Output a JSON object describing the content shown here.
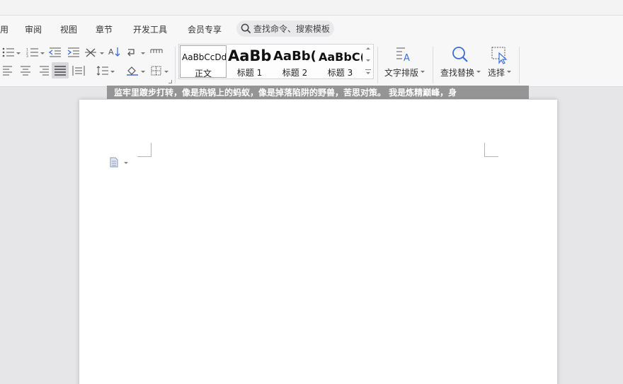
{
  "menu": {
    "items": [
      "用",
      "审阅",
      "视图",
      "章节",
      "开发工具",
      "会员专享"
    ],
    "search_label": "查找命令、搜索模板"
  },
  "icons": {
    "search": "search-icon",
    "bullet_list": "bullet-list-icon",
    "numbered_list": "numbered-list-icon",
    "decrease_indent": "decrease-indent-icon",
    "increase_indent": "increase-indent-icon",
    "chinese_layout": "chinese-layout-icon",
    "sort": "sort-icon",
    "paragraph_mark": "paragraph-mark-icon",
    "tab_ruler": "tab-ruler-icon",
    "align_left": "align-left-icon",
    "align_center": "align-center-icon",
    "align_right": "align-right-icon",
    "justify": "justify-icon",
    "distributed": "distributed-align-icon",
    "line_spacing": "line-spacing-icon",
    "shading": "shading-icon",
    "borders": "borders-icon",
    "text_layout": "text-layout-icon",
    "find_replace": "find-replace-icon",
    "select": "select-cursor-icon",
    "doc": "document-icon"
  },
  "styles": [
    {
      "sample": "AaBbCcDd",
      "name": "正文"
    },
    {
      "sample": "AaBb",
      "name": "标题 1"
    },
    {
      "sample": "AaBb(",
      "name": "标题 2"
    },
    {
      "sample": "AaBbC(",
      "name": "标题 3"
    }
  ],
  "ribbon": {
    "text_layout_label": "文字排版",
    "find_replace_label": "查找替换",
    "select_label": "选择"
  },
  "subtitle": "监牢里踱步打转，像是热锅上的蚂蚁，像是掉落陷阱的野兽，苦思对策。 我是炼精巅峰，身",
  "colors": {
    "accent": "#3a6ed8",
    "ribbon_bg": "#f7f7f8",
    "canvas_bg": "#e6e6e9"
  }
}
